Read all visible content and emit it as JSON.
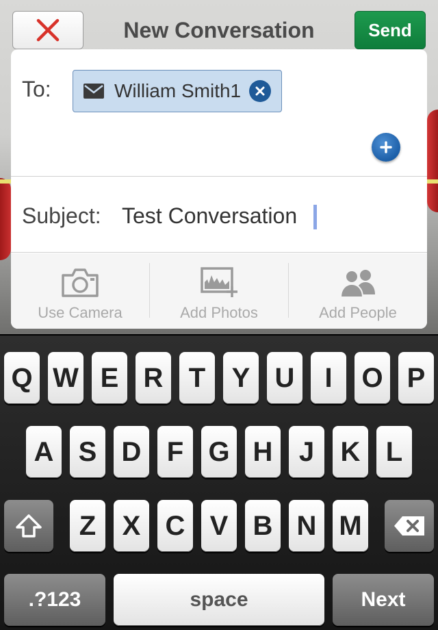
{
  "header": {
    "title": "New Conversation",
    "close_icon": "close-x-icon",
    "send_label": "Send"
  },
  "compose": {
    "to_label": "To:",
    "recipients": [
      {
        "name": "William Smith1",
        "icon": "mail-icon"
      }
    ],
    "subject_label": "Subject:",
    "subject_value": "Test Conversation"
  },
  "actions": [
    {
      "label": "Use Camera",
      "icon": "camera-icon"
    },
    {
      "label": "Add Photos",
      "icon": "add-photos-icon"
    },
    {
      "label": "Add People",
      "icon": "people-icon"
    }
  ],
  "keyboard": {
    "row1": [
      "Q",
      "W",
      "E",
      "R",
      "T",
      "Y",
      "U",
      "I",
      "O",
      "P"
    ],
    "row2": [
      "A",
      "S",
      "D",
      "F",
      "G",
      "H",
      "J",
      "K",
      "L"
    ],
    "row3": [
      "Z",
      "X",
      "C",
      "V",
      "B",
      "N",
      "M"
    ],
    "numbers_label": ".?123",
    "space_label": "space",
    "next_label": "Next"
  },
  "colors": {
    "send_green": "#0f7d3b",
    "close_red": "#d8322a",
    "chip_bg": "#c9dcef",
    "chip_remove_blue": "#1f5a98"
  }
}
